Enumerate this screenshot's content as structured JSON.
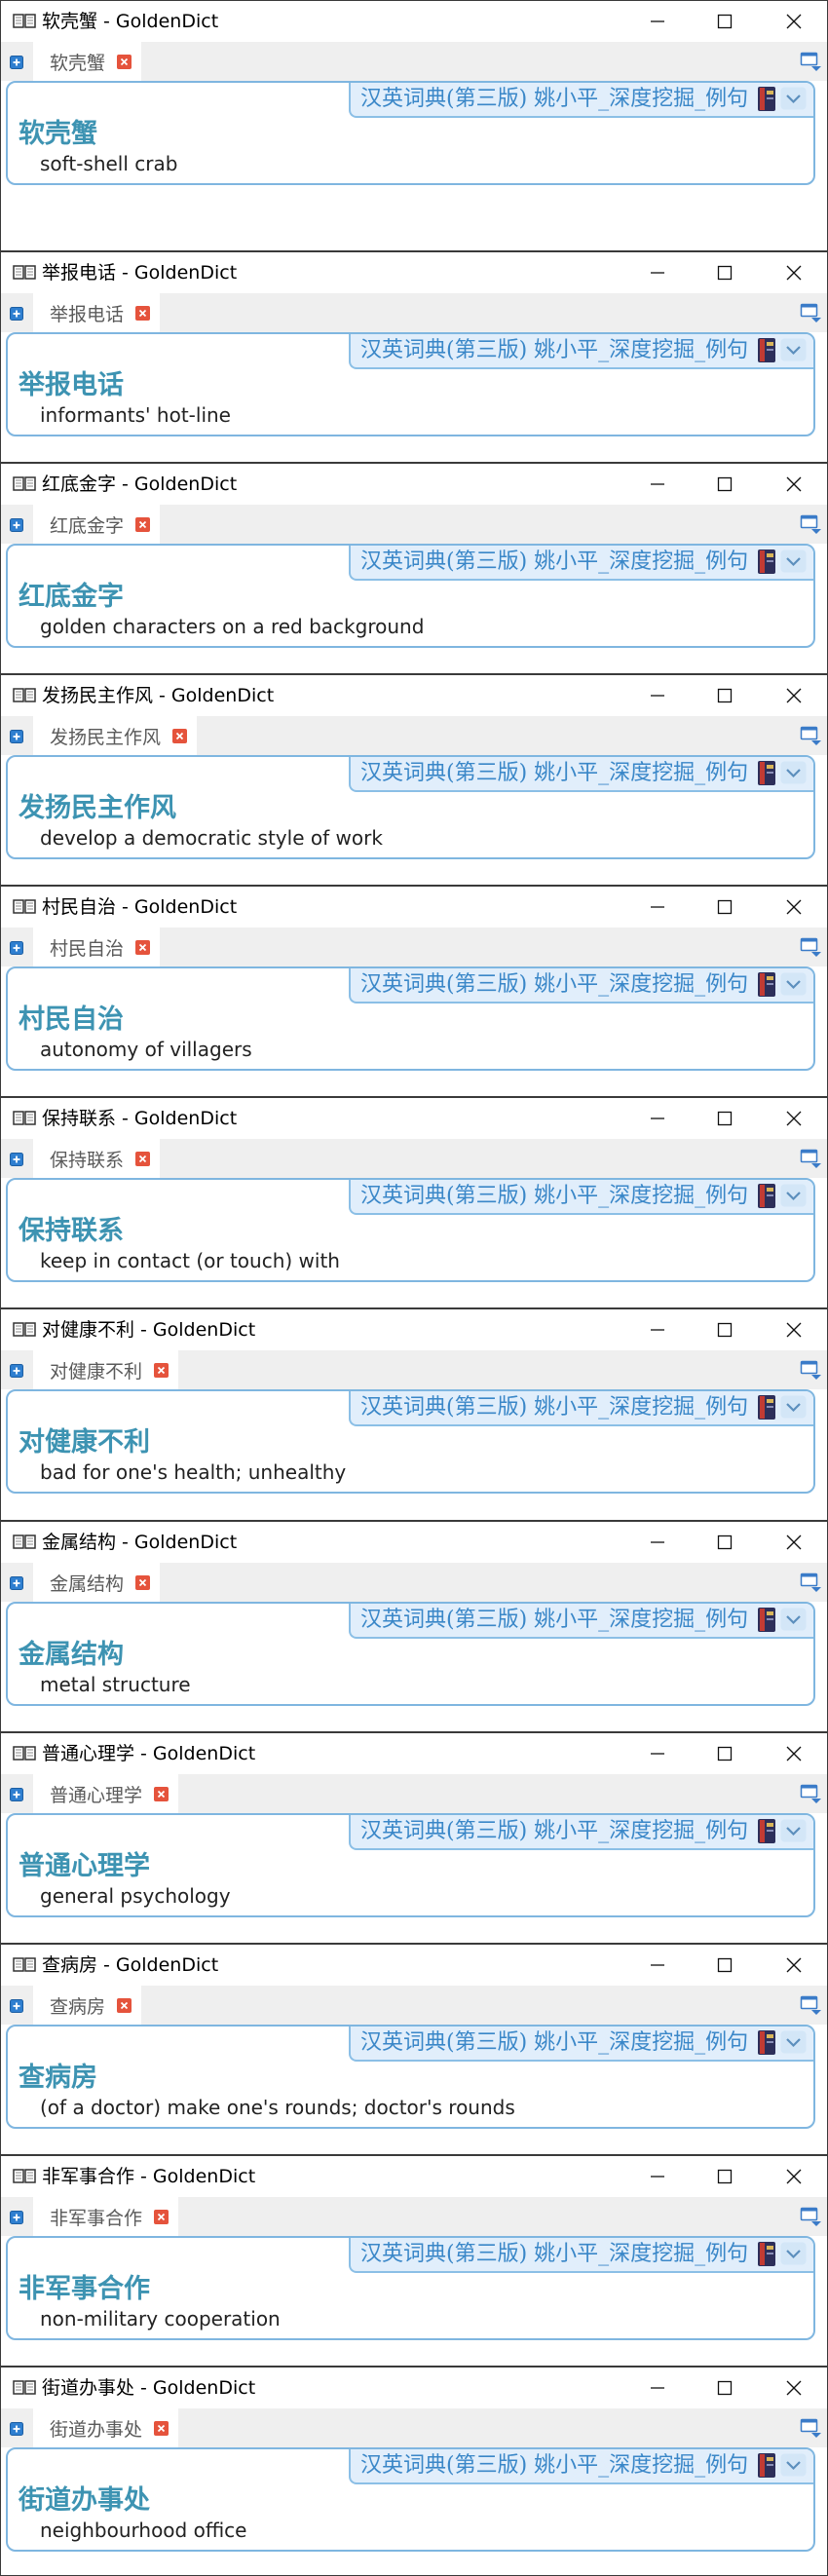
{
  "app_name": "GoldenDict",
  "dictionary_name": "汉英词典(第三版) 姚小平_深度挖掘_例句",
  "icons": {
    "app": "book-icon",
    "minimize": "minimize-icon",
    "maximize": "maximize-icon",
    "close": "close-icon",
    "new_tab": "plus-icon",
    "tab_close": "close-icon",
    "tab_menu": "tab-list-icon",
    "dictionary": "dictionary-book-icon",
    "collapse": "chevron-down-icon"
  },
  "colors": {
    "headword": "#3d93b2",
    "dictionary_bar": "#e1eefb",
    "dictionary_text": "#3a87c8",
    "article_border": "#7fb6e0",
    "tab_close": "#e5533c"
  },
  "windows": [
    {
      "title": "软壳蟹 - GoldenDict",
      "tab_label": "软壳蟹",
      "headword": "软壳蟹",
      "definition": "soft-shell crab"
    },
    {
      "title": "举报电话 - GoldenDict",
      "tab_label": "举报电话",
      "headword": "举报电话",
      "definition": "informants' hot-line"
    },
    {
      "title": "红底金字 - GoldenDict",
      "tab_label": "红底金字",
      "headword": "红底金字",
      "definition": "golden characters on a red background"
    },
    {
      "title": "发扬民主作风 - GoldenDict",
      "tab_label": "发扬民主作风",
      "headword": "发扬民主作风",
      "definition": "develop a democratic style of work"
    },
    {
      "title": "村民自治 - GoldenDict",
      "tab_label": "村民自治",
      "headword": "村民自治",
      "definition": "autonomy of villagers"
    },
    {
      "title": "保持联系 - GoldenDict",
      "tab_label": "保持联系",
      "headword": "保持联系",
      "definition": "keep in contact (or touch) with"
    },
    {
      "title": "对健康不利 - GoldenDict",
      "tab_label": "对健康不利",
      "headword": "对健康不利",
      "definition": "bad for one's health; unhealthy"
    },
    {
      "title": "金属结构 - GoldenDict",
      "tab_label": "金属结构",
      "headword": "金属结构",
      "definition": "metal structure"
    },
    {
      "title": "普通心理学 - GoldenDict",
      "tab_label": "普通心理学",
      "headword": "普通心理学",
      "definition": "general psychology"
    },
    {
      "title": "查病房 - GoldenDict",
      "tab_label": "查病房",
      "headword": "查病房",
      "definition": "(of a doctor) make one's rounds; doctor's rounds"
    },
    {
      "title": "非军事合作 - GoldenDict",
      "tab_label": "非军事合作",
      "headword": "非军事合作",
      "definition": "non-military cooperation"
    },
    {
      "title": "街道办事处 - GoldenDict",
      "tab_label": "街道办事处",
      "headword": "街道办事处",
      "definition": "neighbourhood office"
    }
  ]
}
